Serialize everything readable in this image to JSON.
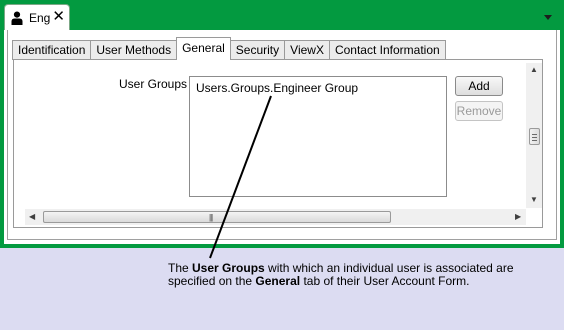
{
  "document_tab": {
    "icon": "user-icon",
    "title": "Eng",
    "close_glyph": "✕"
  },
  "window_menu": {
    "icon": "dropdown-arrow-icon"
  },
  "tabs": [
    {
      "label": "Identification",
      "active": false
    },
    {
      "label": "User Methods",
      "active": false
    },
    {
      "label": "General",
      "active": true
    },
    {
      "label": "Security",
      "active": false
    },
    {
      "label": "ViewX",
      "active": false
    },
    {
      "label": "Contact Information",
      "active": false
    }
  ],
  "general_tab": {
    "user_groups_label": "User Groups",
    "user_groups_items": [
      "Users.Groups.Engineer Group"
    ],
    "add_button": "Add",
    "remove_button": "Remove",
    "remove_enabled": false
  },
  "caption": {
    "part1": "The ",
    "bold1": "User Groups",
    "part2": " with which an individual user is associated are specified on the ",
    "bold2": "General",
    "part3": " tab of their User Account Form."
  },
  "colors": {
    "frame_green": "#039a40",
    "background": "#dcdcf2"
  }
}
